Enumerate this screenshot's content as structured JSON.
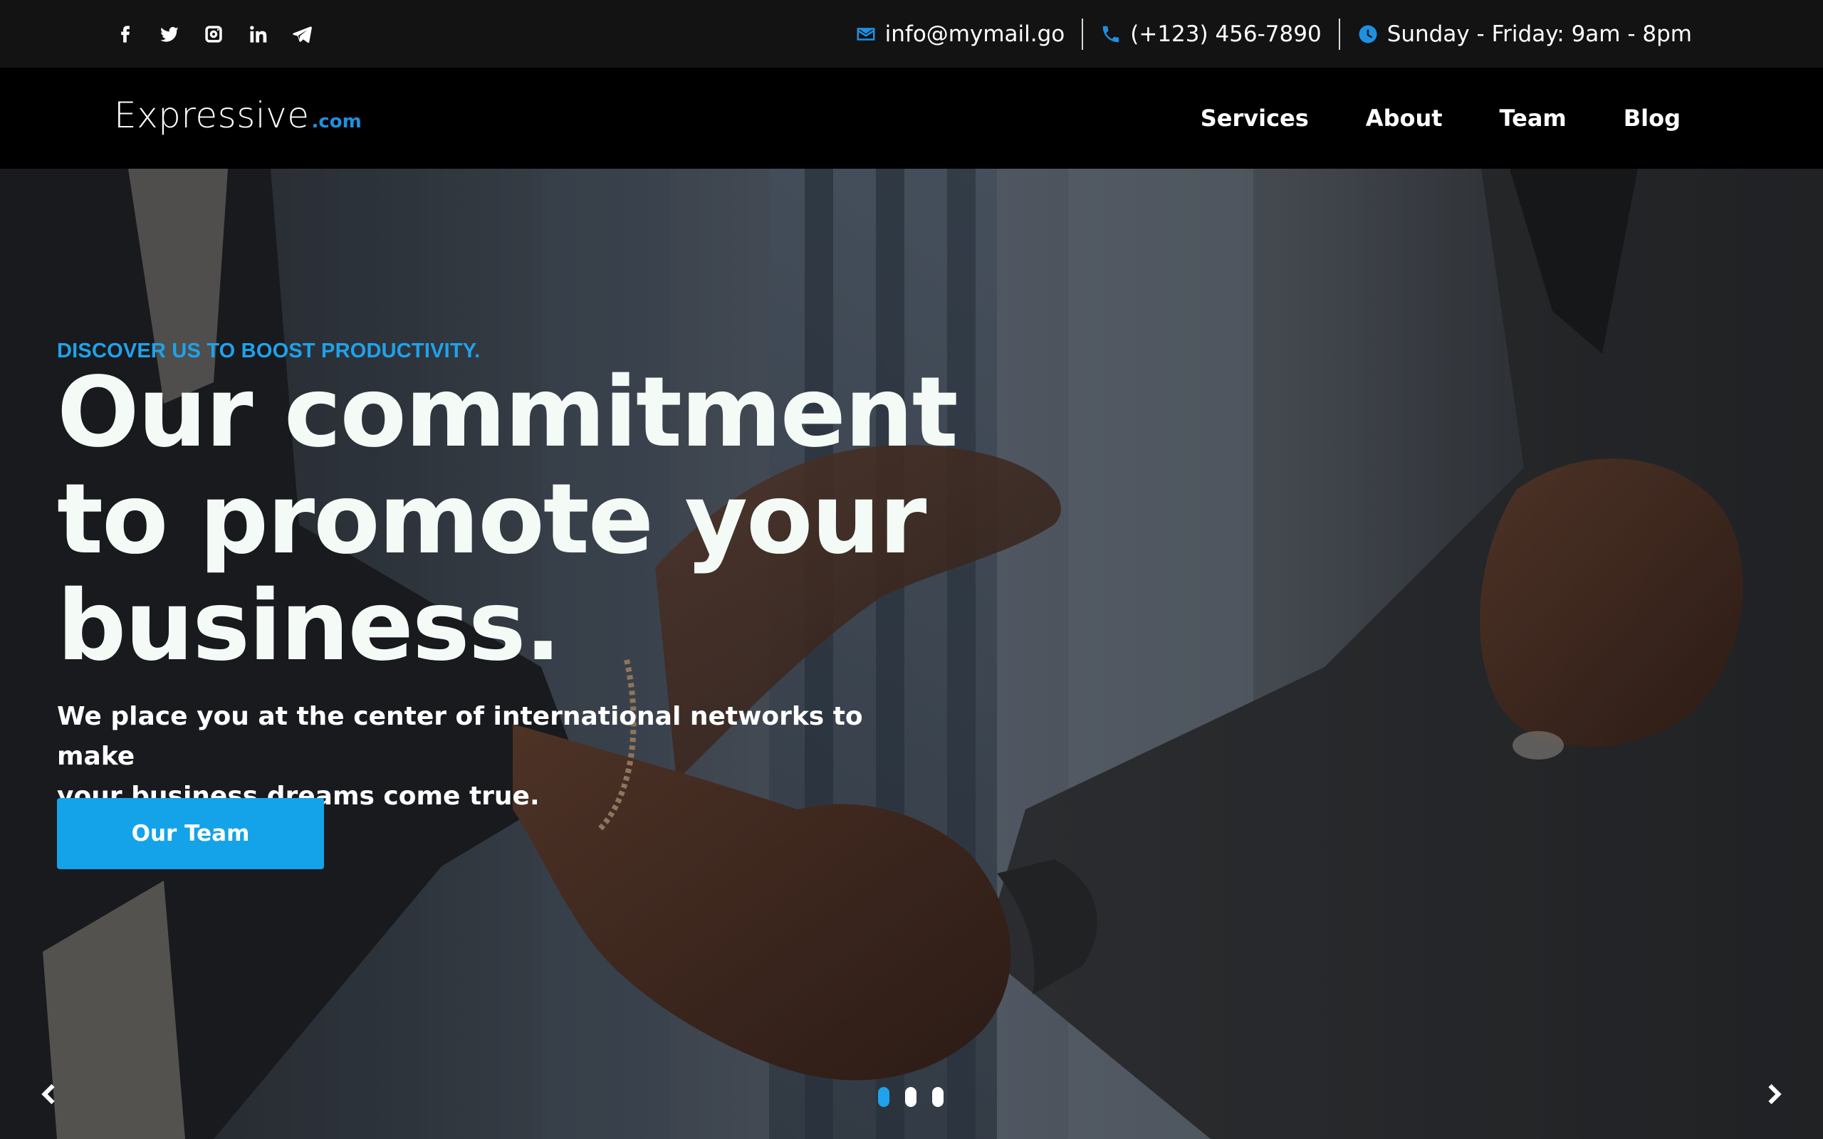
{
  "topbar": {
    "social_icons": [
      "facebook-icon",
      "twitter-icon",
      "instagram-icon",
      "linkedin-icon",
      "telegram-icon"
    ],
    "email": "info@mymail.go",
    "phone": "(+123) 456-7890",
    "hours": "Sunday - Friday: 9am - 8pm",
    "contact_icons": [
      "mail-icon",
      "phone-icon",
      "clock-icon"
    ]
  },
  "navbar": {
    "logo_main": "Expressive",
    "logo_tld": ".com",
    "links": [
      "Services",
      "About",
      "Team",
      "Blog"
    ]
  },
  "hero": {
    "eyebrow": "DISCOVER US TO BOOST PRODUCTIVITY.",
    "headline_line1": "Our commitment",
    "headline_line2": "to promote your",
    "headline_line3": "business.",
    "subtext_line1": "We place you at the center of international networks to make",
    "subtext_line2": "your business dreams come true.",
    "cta_label": "Our Team",
    "slide_count": 3,
    "active_slide": 1
  },
  "colors": {
    "accent": "#1fa2ec",
    "cta_bg": "#14a3e8",
    "topbar_bg": "#131313",
    "navbar_bg": "#000000",
    "headline": "#f4fbf6"
  }
}
